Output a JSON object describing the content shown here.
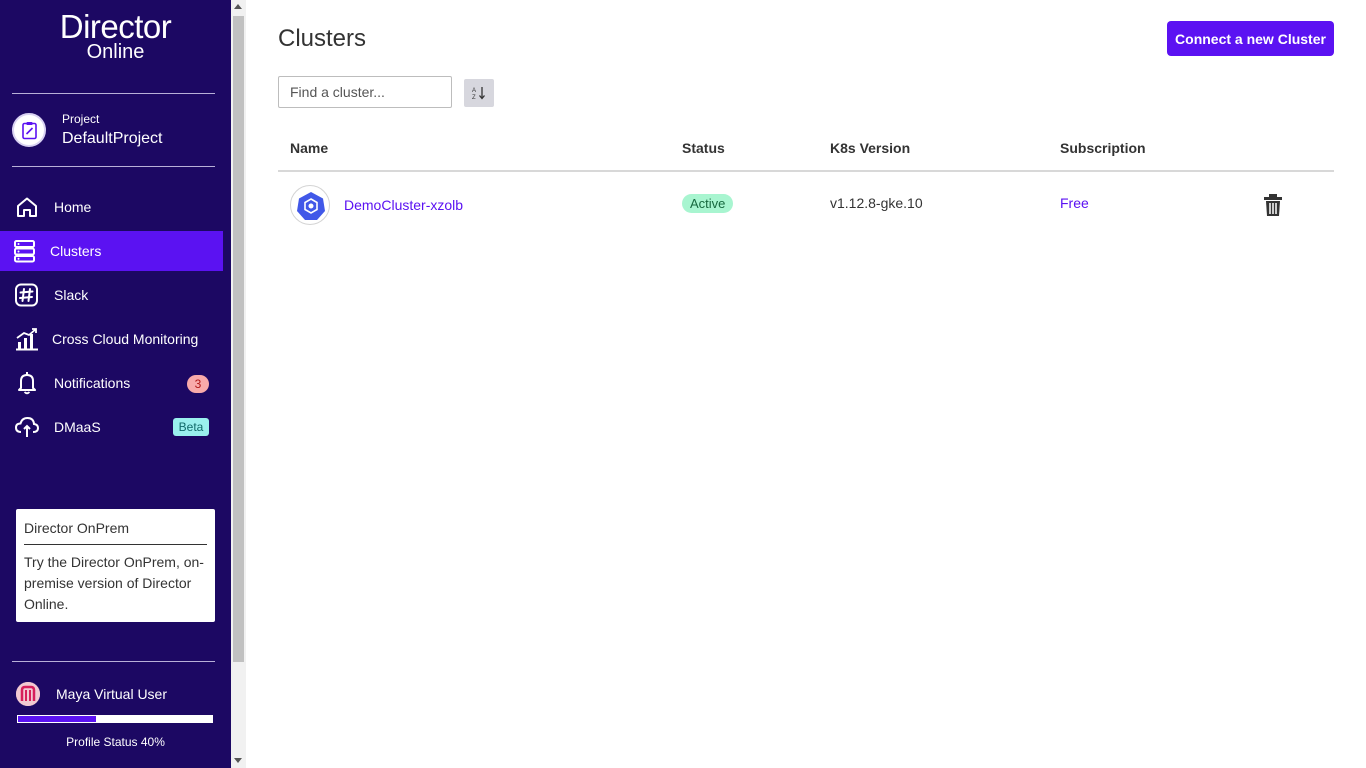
{
  "app": {
    "logo_main": "Director",
    "logo_sub": "Online"
  },
  "colors": {
    "sidebar_bg": "#1c0863",
    "accent": "#5b12f2",
    "status_active_bg": "#a8f5d0",
    "notification_badge": "#f8aaaa",
    "beta_badge": "#9af0ee"
  },
  "project": {
    "label": "Project",
    "name": "DefaultProject",
    "icon": "clipboard-icon"
  },
  "sidebar": {
    "items": [
      {
        "label": "Home",
        "icon": "home-icon",
        "active": false
      },
      {
        "label": "Clusters",
        "icon": "server-stack-icon",
        "active": true
      },
      {
        "label": "Slack",
        "icon": "slack-icon",
        "active": false
      },
      {
        "label": "Cross Cloud Monitoring",
        "icon": "bar-chart-icon",
        "active": false
      },
      {
        "label": "Notifications",
        "icon": "bell-icon",
        "active": false,
        "badge": "3"
      },
      {
        "label": "DMaaS",
        "icon": "cloud-sync-icon",
        "active": false,
        "badge": "Beta"
      }
    ]
  },
  "promo": {
    "title": "Director OnPrem",
    "body": "Try the Director OnPrem, on-premise version of Director Online."
  },
  "user": {
    "name": "Maya Virtual User",
    "profile_status_label": "Profile Status 40%",
    "profile_progress": 0.4
  },
  "main": {
    "title": "Clusters",
    "connect_button": "Connect a new Cluster",
    "search": {
      "placeholder": "Find a cluster...",
      "value": ""
    },
    "sort_icon": "sort-icon",
    "table": {
      "headers": [
        "Name",
        "Status",
        "K8s Version",
        "Subscription"
      ],
      "rows": [
        {
          "name": "DemoCluster-xzolb",
          "icon": "kubernetes-icon",
          "status": "Active",
          "k8s_version": "v1.12.8-gke.10",
          "subscription": "Free",
          "delete_icon": "trash-icon"
        }
      ]
    }
  }
}
